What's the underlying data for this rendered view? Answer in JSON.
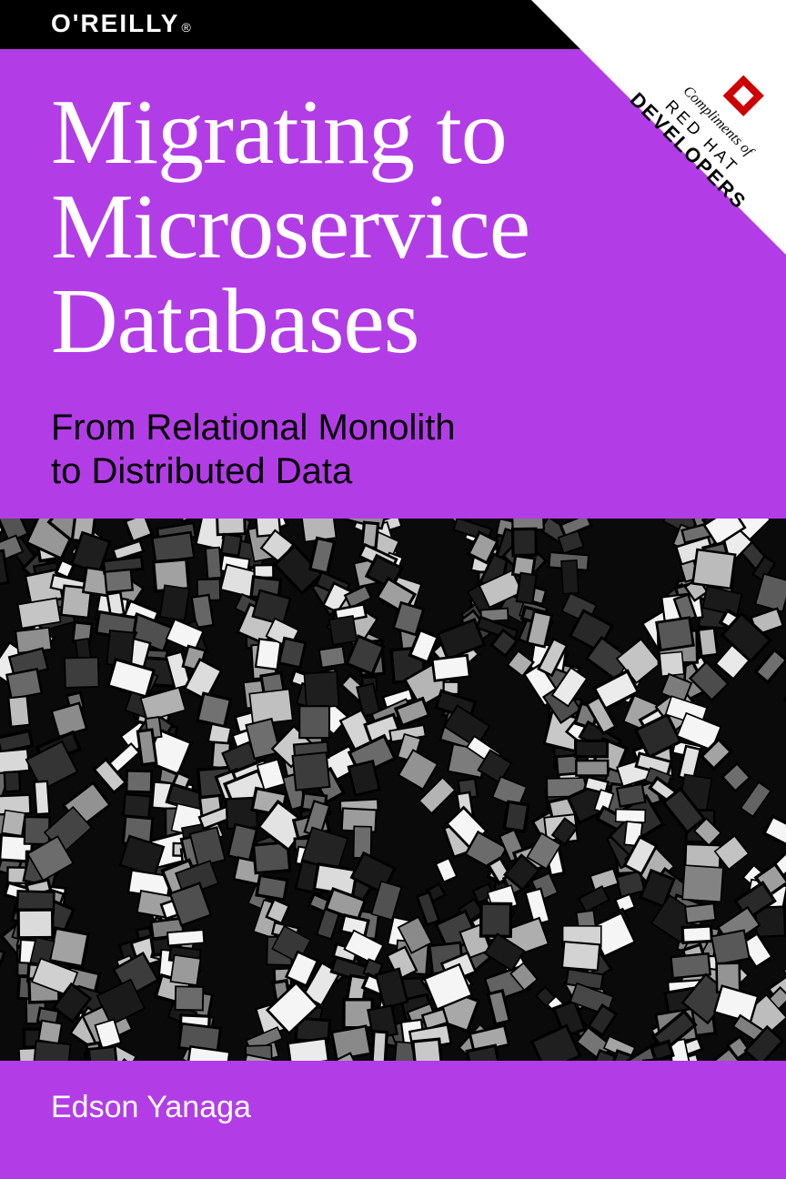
{
  "publisher": {
    "name": "O'REILLY",
    "registered": "®"
  },
  "corner": {
    "compliments": "Compliments of",
    "sponsor_line1": "RED HAT",
    "sponsor_line2": "DEVELOPERS"
  },
  "title_line1": "Migrating to",
  "title_line2": "Microservice",
  "title_line3": "Databases",
  "subtitle_line1": "From Relational Monolith",
  "subtitle_line2": "to Distributed Data",
  "author": "Edson Yanaga",
  "colors": {
    "background": "#b23de6",
    "topbar": "#000000",
    "title": "#ffffff",
    "subtitle": "#000000",
    "author": "#ffffff",
    "sponsor_accent": "#cc0000"
  }
}
